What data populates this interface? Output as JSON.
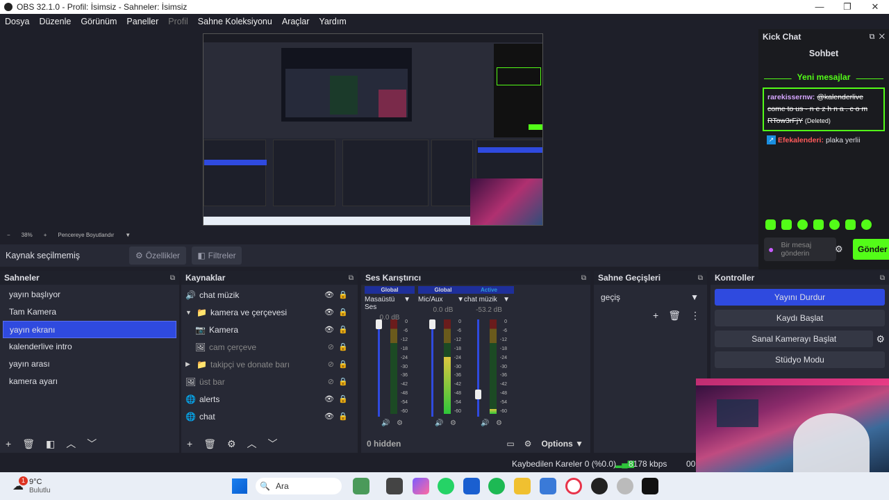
{
  "window": {
    "title": "OBS 32.1.0 - Profil: İsimsiz - Sahneler: İsimsiz",
    "minimize": "—",
    "maximize": "❐",
    "close": "✕"
  },
  "menu": [
    "Dosya",
    "Düzenle",
    "Görünüm",
    "Paneller",
    "Profil",
    "Sahne Koleksiyonu",
    "Araçlar",
    "Yardım"
  ],
  "preview": {
    "zoom": "38%",
    "zoom_minus": "−",
    "zoom_plus": "+",
    "fit_label": "Pencereye Boyutlandır"
  },
  "source_toolbar": {
    "status": "Kaynak seçilmemiş",
    "properties": "Özellikler",
    "filters": "Filtreler"
  },
  "scenes": {
    "title": "Sahneler",
    "items": [
      "yayın başlıyor",
      "Tam Kamera",
      "yayın ekranı",
      "kalenderlive intro",
      "yayın arası",
      "kamera ayarı"
    ],
    "selected_index": 2
  },
  "sources": {
    "title": "Kaynaklar",
    "items": [
      {
        "name": "chat müzik",
        "icon": "speaker-icon",
        "glyph": "🔊",
        "indent": 0,
        "dim": false,
        "visible": true
      },
      {
        "name": "kamera ve çerçevesi",
        "icon": "folder-icon",
        "glyph": "📁",
        "indent": 1,
        "dim": false,
        "visible": true,
        "expander": "▼"
      },
      {
        "name": "Kamera",
        "icon": "camera-icon",
        "glyph": "📷",
        "indent": 2,
        "dim": false,
        "visible": true
      },
      {
        "name": "cam çerçeve",
        "icon": "image-icon",
        "glyph": "🖼",
        "indent": 2,
        "dim": true,
        "visible": false
      },
      {
        "name": "takipçi ve donate barı",
        "icon": "folder-icon",
        "glyph": "📁",
        "indent": 1,
        "dim": true,
        "visible": false,
        "expander": "▶"
      },
      {
        "name": "üst bar",
        "icon": "image-icon",
        "glyph": "🖼",
        "indent": 0,
        "dim": true,
        "visible": false
      },
      {
        "name": "alerts",
        "icon": "globe-icon",
        "glyph": "🌐",
        "indent": 0,
        "dim": false,
        "visible": true
      },
      {
        "name": "chat",
        "icon": "globe-icon",
        "glyph": "🌐",
        "indent": 0,
        "dim": false,
        "visible": true
      }
    ]
  },
  "mixer": {
    "title": "Ses Karıştırıcı",
    "channels": [
      {
        "tag": "Global",
        "name": "Masaüstü Ses",
        "db": "0.0 dB",
        "level": 0.0
      },
      {
        "tag": "Global",
        "name": "Mic/Aux",
        "db": "0.0 dB",
        "level": 0.6
      },
      {
        "tag": "Active",
        "name": "chat müzik",
        "db": "-53.2 dB",
        "level": 0.05
      }
    ],
    "scale": [
      "0",
      "-6",
      "-12",
      "-18",
      "-24",
      "-30",
      "-36",
      "-42",
      "-48",
      "-54",
      "-60"
    ],
    "hidden": "0 hidden",
    "options": "Options"
  },
  "transitions": {
    "title": "Sahne Geçişleri",
    "selected": "geçiş"
  },
  "controls": {
    "title": "Kontroller",
    "buttons": [
      "Yayını Durdur",
      "Kaydı Başlat",
      "Sanal Kamerayı Başlat",
      "Stüdyo Modu"
    ]
  },
  "status": {
    "dropped": "Kaybedilen Kareler 0 (%0.0)",
    "bitrate": "8178 kbps",
    "time": "00:"
  },
  "chat": {
    "title": "Kick Chat",
    "tab": "Sohbet",
    "new_messages": "Yeni mesajlar",
    "msg1_user": "rarekissernw:",
    "msg1_text": "@kalenderlive come to us - n e z h n a . c o m RTow3rFjY",
    "msg1_deleted": "(Deleted)",
    "msg2_user": "Efekalenderi:",
    "msg2_text": "plaka yerlii",
    "input_placeholder": "Bir mesaj gönderin",
    "send": "Gönder"
  },
  "taskbar": {
    "weather_temp": "9°C",
    "weather_desc": "Bulutlu",
    "badge": "1",
    "search": "Ara"
  },
  "colors": {
    "accent": "#2f4adf",
    "chat_green": "#53fc18",
    "bg": "#1e1f29",
    "panel": "#272935"
  }
}
